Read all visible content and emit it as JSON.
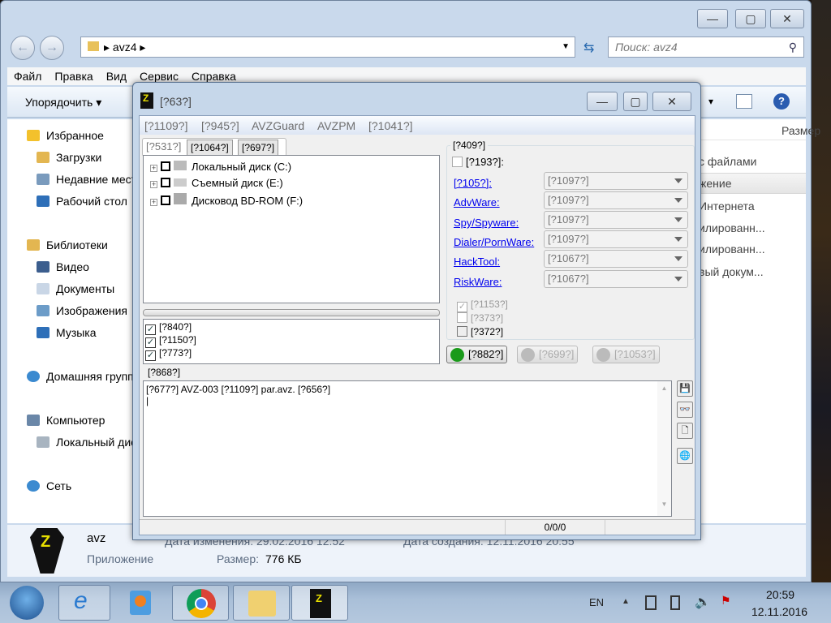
{
  "explorer": {
    "path": "avz4",
    "search_placeholder": "Поиск: avz4",
    "menu": [
      "Файл",
      "Правка",
      "Вид",
      "Сервис",
      "Справка"
    ],
    "organize": "Упорядочить",
    "nav": {
      "favorites": "Избранное",
      "downloads": "Загрузки",
      "recent": "Недавние места",
      "desktop": "Рабочий стол",
      "libraries": "Библиотеки",
      "video": "Видео",
      "docs": "Документы",
      "images": "Изображения",
      "music": "Музыка",
      "homegroup": "Домашняя группа",
      "computer": "Компьютер",
      "local_disk": "Локальный диск (C:)",
      "network": "Сеть"
    },
    "column_size": "Размер",
    "list": [
      "с файлами",
      "жение",
      "Интернета",
      "илированн...",
      "илированн...",
      "вый докум..."
    ],
    "details": {
      "name": "avz",
      "type": "Приложение",
      "modified": "Дата изменения: 29.02.2016 12:52",
      "created": "Дата создания: 12.11.2016 20:55",
      "size_label": "Размер:",
      "size": "776 КБ"
    }
  },
  "avz": {
    "title": "[?63?]",
    "menu": [
      "[?1109?]",
      "[?945?]",
      "AVZGuard",
      "AVZPM",
      "[?1041?]"
    ],
    "tabs": [
      "[?531?]",
      "[?1064?]",
      "[?697?]"
    ],
    "drives": [
      "Локальный диск (C:)",
      "Съемный диск (E:)",
      "Дисковод BD-ROM (F:)"
    ],
    "options": [
      "[?840?]",
      "[?1150?]",
      "[?773?]"
    ],
    "group_title": "[?409?]",
    "group_check": "[?193?]:",
    "categories": [
      {
        "label": "[?105?]:",
        "value": "[?1097?]"
      },
      {
        "label": "AdvWare:",
        "value": "[?1097?]"
      },
      {
        "label": "Spy/Spyware:",
        "value": "[?1097?]"
      },
      {
        "label": "Dialer/PornWare:",
        "value": "[?1097?]"
      },
      {
        "label": "HackTool:",
        "value": "[?1067?]"
      },
      {
        "label": "RiskWare:",
        "value": "[?1067?]"
      }
    ],
    "extra_checks": [
      "[?1153?]",
      "[?373?]",
      "[?372?]"
    ],
    "start": "[?882?]",
    "pause": "[?699?]",
    "stop": "[?1053?]",
    "log_title": "[?868?]",
    "log_text": "[?677?] AVZ-003 [?1109?] par.avz. [?656?]",
    "status": "0/0/0"
  },
  "taskbar": {
    "lang": "EN",
    "time": "20:59",
    "date": "12.11.2016"
  }
}
